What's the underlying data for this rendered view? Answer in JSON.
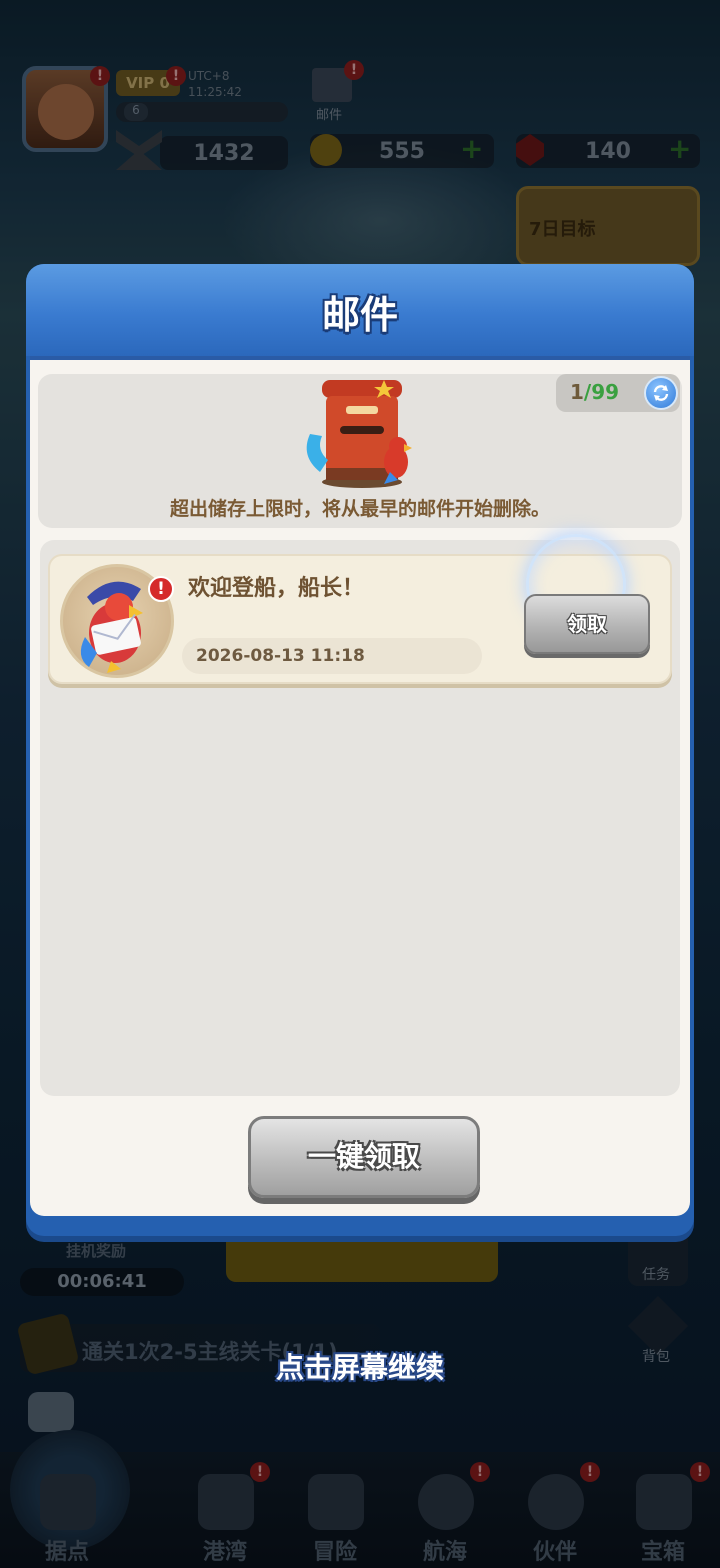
{
  "hud": {
    "vip": "VIP 0",
    "timezone": "UTC+8",
    "clock": "11:25:42",
    "level": "6",
    "mail_label": "邮件",
    "power": "1432",
    "gold": "555",
    "gems": "140",
    "goal_label": "7日目标",
    "badge": "!"
  },
  "bottom_hud": {
    "idle_reward_label": "挂机奖励",
    "idle_timer": "00:06:41",
    "quest_text": "通关1次2-5主线关卡(1/1)",
    "task_label": "任务",
    "bag_label": "背包"
  },
  "overlay": {
    "continue_text": "点击屏幕继续"
  },
  "nav": {
    "items": [
      {
        "label": "据点"
      },
      {
        "label": "港湾"
      },
      {
        "label": "冒险"
      },
      {
        "label": "航海"
      },
      {
        "label": "伙伴"
      },
      {
        "label": "宝箱"
      }
    ]
  },
  "mail_modal": {
    "title": "邮件",
    "counter_current": "1",
    "counter_total": "/99",
    "storage_notice": "超出储存上限时，将从最早的邮件开始删除。",
    "mails": [
      {
        "title": "欢迎登船，船长！",
        "date": "2026-08-13 11:18",
        "claim_label": "领取",
        "badge": "!"
      }
    ],
    "claim_all_label": "一键领取"
  },
  "colors": {
    "header_blue": "#3a7bd0",
    "body_cream": "#f7f4ef",
    "counter_green": "#3aa040",
    "text_brown": "#7a5a34",
    "badge_red": "#d52a2a"
  }
}
